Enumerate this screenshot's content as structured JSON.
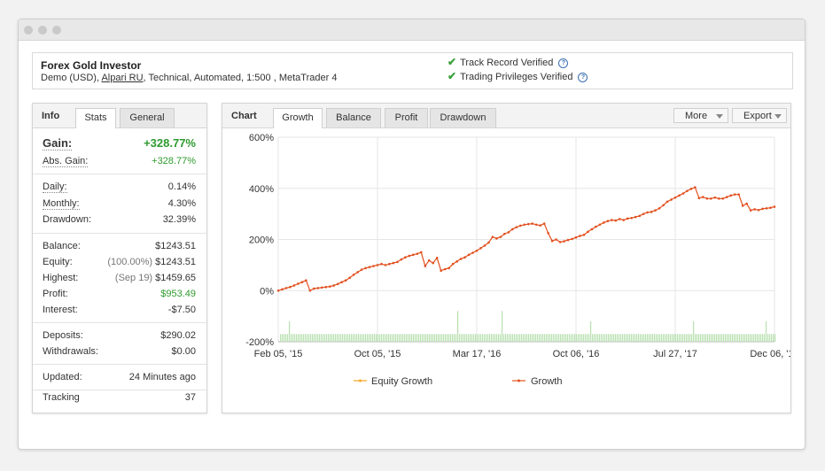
{
  "header": {
    "system_name": "Forex Gold Investor",
    "sub_pre": "Demo (USD), ",
    "sub_broker": "Alpari RU",
    "sub_post": ", Technical, Automated, 1:500 , MetaTrader 4",
    "verify_1": "Track Record Verified",
    "verify_2": "Trading Privileges Verified",
    "help_glyph": "?"
  },
  "info": {
    "title": "Info",
    "tabs": [
      "Stats",
      "General"
    ],
    "gain_label": "Gain:",
    "gain_value": "+328.77%",
    "abs_gain_label": "Abs. Gain:",
    "abs_gain_value": "+328.77%",
    "daily_label": "Daily:",
    "daily_value": "0.14%",
    "monthly_label": "Monthly:",
    "monthly_value": "4.30%",
    "drawdown_label": "Drawdown:",
    "drawdown_value": "32.39%",
    "balance_label": "Balance:",
    "balance_value": "$1243.51",
    "equity_label": "Equity:",
    "equity_pre": "(100.00%)",
    "equity_value": "$1243.51",
    "highest_label": "Highest:",
    "highest_pre": "(Sep 19)",
    "highest_value": "$1459.65",
    "profit_label": "Profit:",
    "profit_value": "$953.49",
    "interest_label": "Interest:",
    "interest_value": "-$7.50",
    "deposits_label": "Deposits:",
    "deposits_value": "$290.02",
    "withdrawals_label": "Withdrawals:",
    "withdrawals_value": "$0.00",
    "updated_label": "Updated:",
    "updated_value": "24 Minutes ago",
    "tracking_label": "Tracking",
    "tracking_value": "37"
  },
  "chart_panel": {
    "title": "Chart",
    "tabs": [
      "Growth",
      "Balance",
      "Profit",
      "Drawdown"
    ],
    "more_label": "More",
    "export_label": "Export"
  },
  "colors": {
    "growth_line": "#e2501f",
    "equity_line": "#f5a623",
    "volume_bars": "#b8e0b0",
    "gain_green": "#2e9a2e",
    "check_green": "#3aa13a"
  },
  "chart_data": {
    "type": "line",
    "y_tick_labels": [
      "600%",
      "400%",
      "200%",
      "0%",
      "-200%"
    ],
    "ylim": [
      -200,
      600
    ],
    "x_tick_labels": [
      "Feb 05, '15",
      "Oct 05, '15",
      "Mar 17, '16",
      "Oct 06, '16",
      "Jul 27, '17",
      "Dec 06, '17"
    ],
    "grid": true,
    "legend_position": "bottom",
    "series": [
      {
        "name": "Equity Growth",
        "values": []
      },
      {
        "name": "Growth",
        "values": [
          0,
          5,
          10,
          14,
          20,
          27,
          33,
          40,
          0,
          8,
          10,
          12,
          14,
          16,
          20,
          26,
          33,
          40,
          50,
          62,
          72,
          82,
          88,
          92,
          96,
          100,
          104,
          100,
          104,
          108,
          112,
          122,
          130,
          136,
          140,
          144,
          150,
          96,
          118,
          108,
          128,
          78,
          84,
          88,
          104,
          114,
          124,
          130,
          140,
          148,
          156,
          166,
          176,
          188,
          210,
          204,
          210,
          222,
          228,
          240,
          248,
          254,
          258,
          260,
          262,
          258,
          255,
          262,
          225,
          194,
          200,
          190,
          193,
          198,
          202,
          208,
          214,
          218,
          230,
          240,
          250,
          258,
          266,
          272,
          276,
          274,
          280,
          276,
          282,
          284,
          288,
          292,
          300,
          306,
          308,
          314,
          322,
          334,
          348,
          356,
          364,
          372,
          380,
          390,
          398,
          404,
          362,
          366,
          360,
          360,
          364,
          360,
          360,
          366,
          372,
          376,
          376,
          332,
          340,
          314,
          318,
          315,
          320,
          322,
          324,
          328
        ]
      }
    ],
    "volume_bars": {
      "baseline_percent": -200,
      "typical_top_percent": -170,
      "spikes_top_percent": {
        "5": -120,
        "100": -80,
        "125": -80,
        "175": -120,
        "233": -120,
        "274": -120
      }
    }
  }
}
